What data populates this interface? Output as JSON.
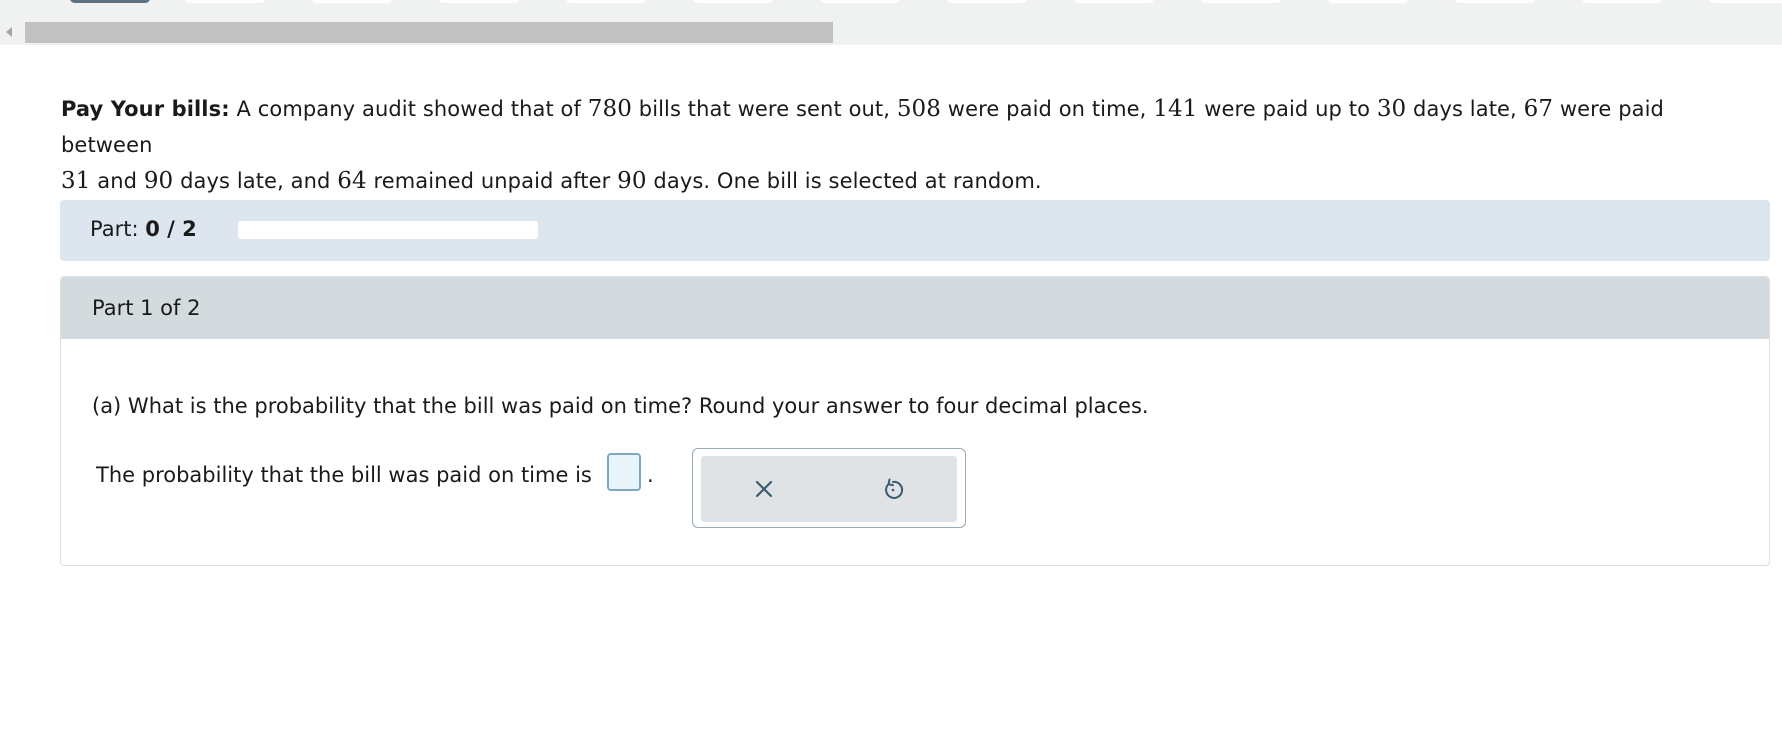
{
  "problem": {
    "title": "Pay Your bills:",
    "text_parts": [
      "A company audit showed that of ",
      "780",
      " bills that were sent out, ",
      "508",
      " were paid on time, ",
      "141",
      " were paid up to ",
      "30",
      " days late, ",
      "67",
      " were paid between ",
      "31",
      " and ",
      "90",
      " days late, and ",
      "64",
      " remained unpaid after ",
      "90",
      " days. One bill is selected at random."
    ]
  },
  "part_bar": {
    "label": "Part:",
    "progress_text": "0 / 2",
    "progress_fraction": 0
  },
  "part_card": {
    "header": "Part 1 of 2",
    "question": "(a) What is the probability that the bill was paid on time? Round your answer to four decimal places.",
    "answer_prefix": "The probability that the bill was paid on time is",
    "answer_value": "",
    "answer_suffix": "."
  },
  "tools": {
    "clear_icon": "close-icon",
    "undo_icon": "undo-icon"
  },
  "colors": {
    "part_bar_bg": "#dde6ef",
    "part_header_bg": "#d3dbdf",
    "input_border": "#7fa7bf",
    "icon_color": "#3b5a6d"
  }
}
